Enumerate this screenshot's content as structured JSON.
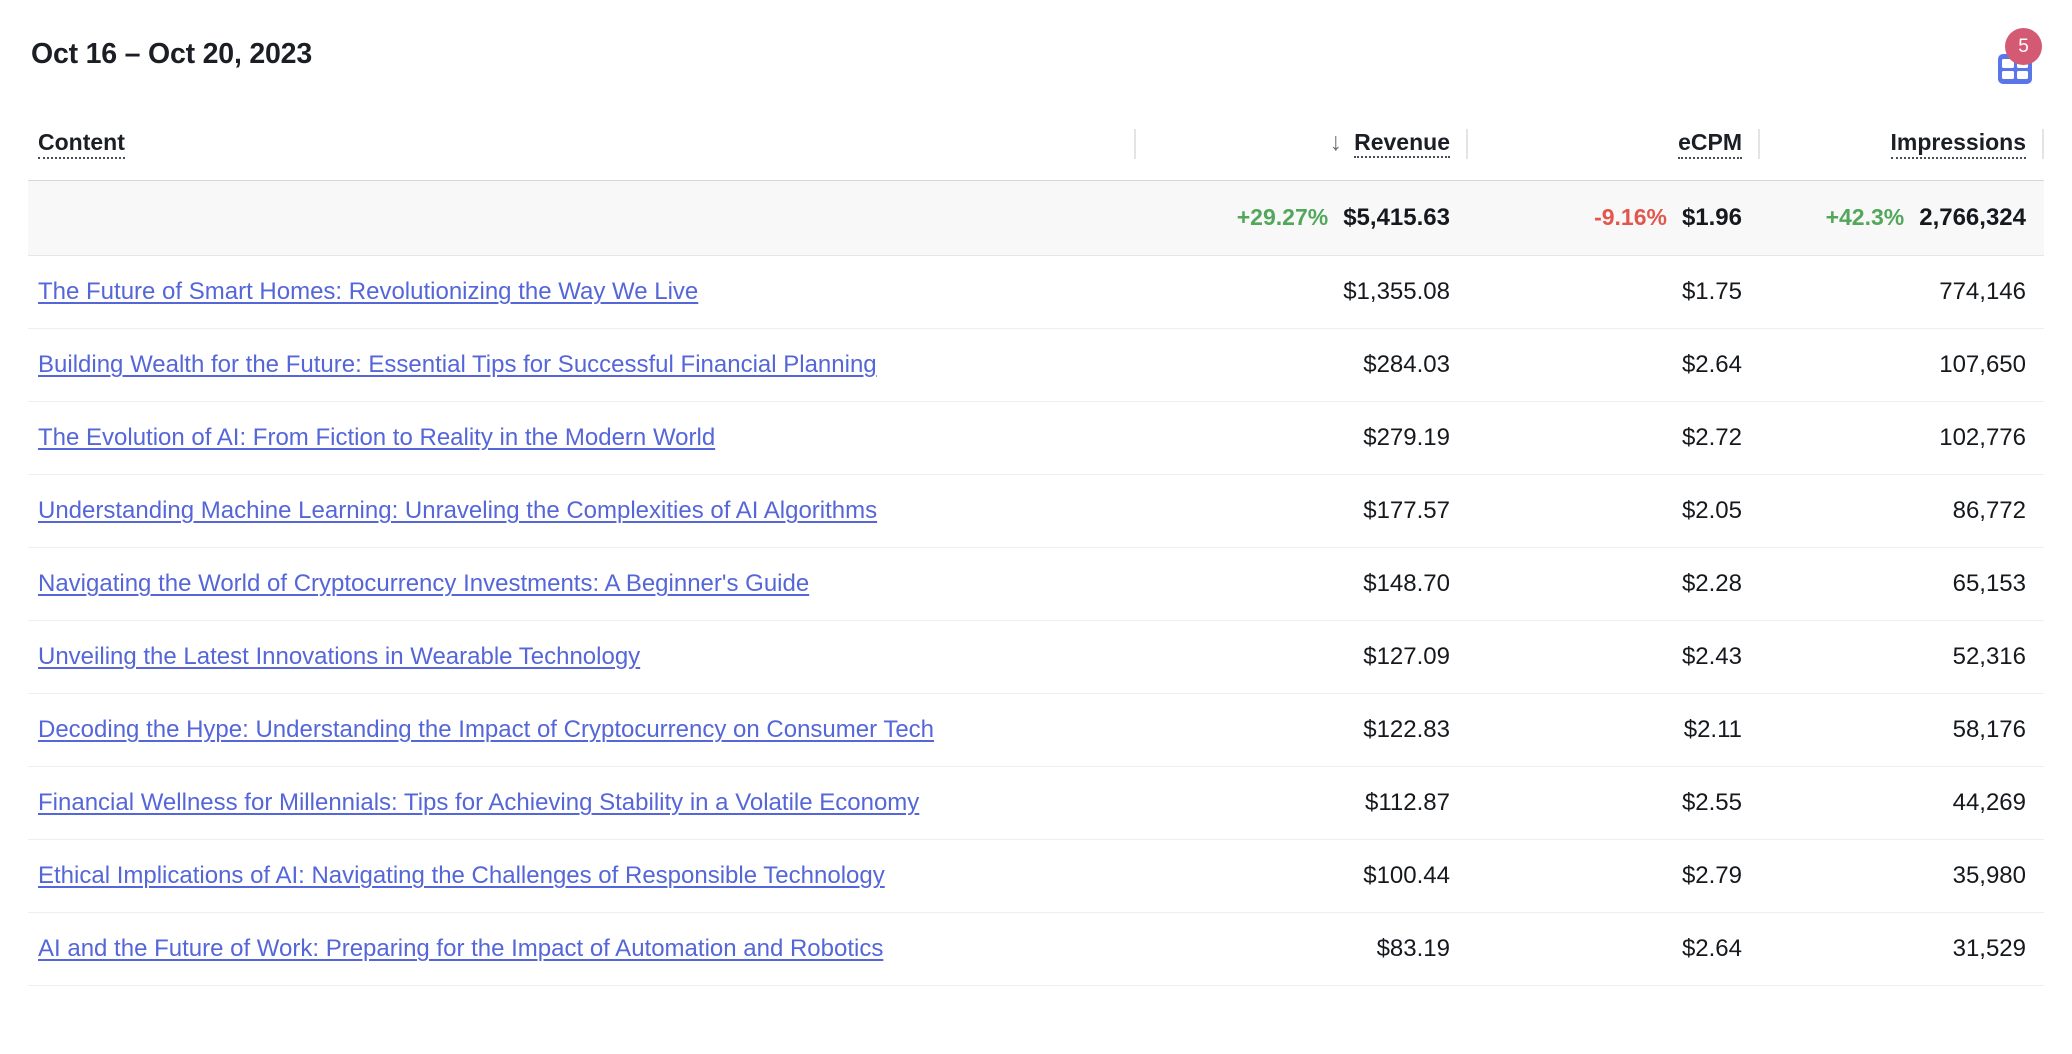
{
  "header": {
    "date_range": "Oct 16 – Oct 20, 2023",
    "table_icon": "table-grid-icon",
    "badge_count": "5"
  },
  "colors": {
    "link": "#5566d8",
    "positive": "#52a75a",
    "negative": "#e2574c",
    "icon_blue": "#5b76e8",
    "badge_pink": "#d45a73",
    "summary_bg": "#f8f8f8"
  },
  "table": {
    "columns": [
      {
        "label": "Content",
        "align": "left",
        "sorted": false
      },
      {
        "label": "Revenue",
        "align": "right",
        "sorted": true,
        "sort_dir": "↓"
      },
      {
        "label": "eCPM",
        "align": "right",
        "sorted": false
      },
      {
        "label": "Impressions",
        "align": "right",
        "sorted": false
      }
    ],
    "summary": {
      "revenue_delta": "+29.27%",
      "revenue_delta_dir": "up",
      "revenue": "$5,415.63",
      "ecpm_delta": "-9.16%",
      "ecpm_delta_dir": "down",
      "ecpm": "$1.96",
      "impressions_delta": "+42.3%",
      "impressions_delta_dir": "up",
      "impressions": "2,766,324"
    },
    "rows": [
      {
        "content": "The Future of Smart Homes: Revolutionizing the Way We Live",
        "revenue": "$1,355.08",
        "ecpm": "$1.75",
        "impressions": "774,146"
      },
      {
        "content": "Building Wealth for the Future: Essential Tips for Successful Financial Planning",
        "revenue": "$284.03",
        "ecpm": "$2.64",
        "impressions": "107,650"
      },
      {
        "content": "The Evolution of AI: From Fiction to Reality in the Modern World",
        "revenue": "$279.19",
        "ecpm": "$2.72",
        "impressions": "102,776"
      },
      {
        "content": "Understanding Machine Learning: Unraveling the Complexities of AI Algorithms",
        "revenue": "$177.57",
        "ecpm": "$2.05",
        "impressions": "86,772"
      },
      {
        "content": "Navigating the World of Cryptocurrency Investments: A Beginner's Guide",
        "revenue": "$148.70",
        "ecpm": "$2.28",
        "impressions": "65,153"
      },
      {
        "content": "Unveiling the Latest Innovations in Wearable Technology",
        "revenue": "$127.09",
        "ecpm": "$2.43",
        "impressions": "52,316"
      },
      {
        "content": "Decoding the Hype: Understanding the Impact of Cryptocurrency on Consumer Tech",
        "revenue": "$122.83",
        "ecpm": "$2.11",
        "impressions": "58,176"
      },
      {
        "content": "Financial Wellness for Millennials: Tips for Achieving Stability in a Volatile Economy",
        "revenue": "$112.87",
        "ecpm": "$2.55",
        "impressions": "44,269"
      },
      {
        "content": "Ethical Implications of AI: Navigating the Challenges of Responsible Technology",
        "revenue": "$100.44",
        "ecpm": "$2.79",
        "impressions": "35,980"
      },
      {
        "content": "AI and the Future of Work: Preparing for the Impact of Automation and Robotics",
        "revenue": "$83.19",
        "ecpm": "$2.64",
        "impressions": "31,529"
      }
    ]
  }
}
